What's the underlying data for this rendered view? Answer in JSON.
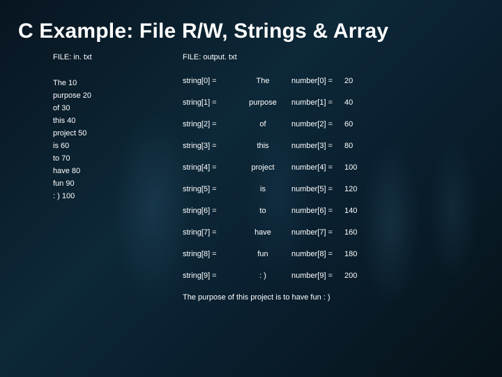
{
  "title": "C Example: File R/W, Strings & Array",
  "left": {
    "header": "FILE: in. txt",
    "lines": [
      "The 10",
      "purpose 20",
      "of 30",
      "this 40",
      "project 50",
      "is 60",
      "to 70",
      "have 80",
      "fun 90",
      ": ) 100"
    ]
  },
  "right": {
    "header": "FILE: output. txt",
    "rows": [
      {
        "sk": "string[0] =",
        "sv": "The",
        "nk": "number[0] =",
        "nv": "20"
      },
      {
        "sk": "string[1] =",
        "sv": "purpose",
        "nk": "number[1] =",
        "nv": "40"
      },
      {
        "sk": "string[2] =",
        "sv": "of",
        "nk": "number[2] =",
        "nv": "60"
      },
      {
        "sk": "string[3] =",
        "sv": "this",
        "nk": "number[3] =",
        "nv": "80"
      },
      {
        "sk": "string[4] =",
        "sv": "project",
        "nk": "number[4] =",
        "nv": "100"
      },
      {
        "sk": "string[5] =",
        "sv": "is",
        "nk": "number[5] =",
        "nv": "120"
      },
      {
        "sk": "string[6] =",
        "sv": "to",
        "nk": "number[6] =",
        "nv": "140"
      },
      {
        "sk": "string[7] =",
        "sv": "have",
        "nk": "number[7] =",
        "nv": "160"
      },
      {
        "sk": "string[8] =",
        "sv": "fun",
        "nk": "number[8] =",
        "nv": "180"
      },
      {
        "sk": "string[9] =",
        "sv": ": )",
        "nk": "number[9] =",
        "nv": "200"
      }
    ],
    "summary": "The purpose of this project is to have fun : )"
  }
}
